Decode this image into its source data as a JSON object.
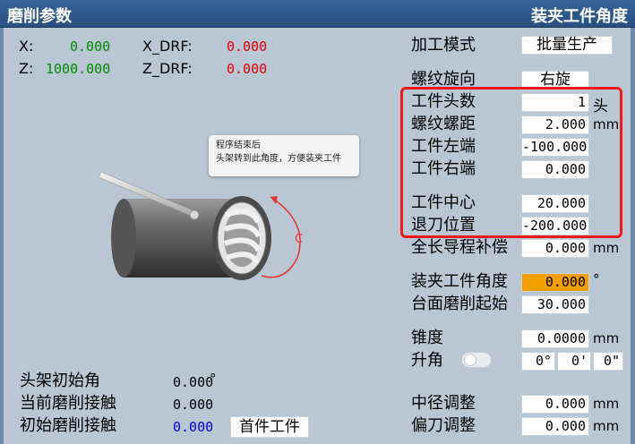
{
  "header": {
    "title_left": "磨削参数",
    "title_right": "装夹工件角度"
  },
  "axes": {
    "x_label": "X:",
    "x_value": "0.000",
    "z_label": "Z:",
    "z_value": "1000.000",
    "xdrf_label": "X_DRF:",
    "xdrf_value": "0.000",
    "zdrf_label": "Z_DRF:",
    "zdrf_value": "0.000"
  },
  "callout": {
    "line1": "程序结束后",
    "line2": "头架转到此角度，方便装夹工件"
  },
  "diagram": {
    "rotation_label": "C"
  },
  "params": {
    "mode_label": "加工模式",
    "mode_value": "批量生产",
    "thread_dir_label": "螺纹旋向",
    "thread_dir_value": "右旋",
    "starts_label": "工件头数",
    "starts_value": "1",
    "starts_unit": "头",
    "pitch_label": "螺纹螺距",
    "pitch_value": "2.000",
    "pitch_unit": "mm",
    "left_label": "工件左端",
    "left_value": "-100.000",
    "right_label": "工件右端",
    "right_value": "0.000",
    "center_label": "工件中心",
    "center_value": "20.000",
    "retract_label": "退刀位置",
    "retract_value": "-200.000",
    "lead_comp_label": "全长导程补偿",
    "lead_comp_value": "0.000",
    "lead_comp_unit": "mm",
    "clamp_angle_label": "装夹工件角度",
    "clamp_angle_value": "0.000",
    "clamp_angle_unit": "°",
    "face_start_label": "台面磨削起始",
    "face_start_value": "30.000",
    "taper_label": "锥度",
    "taper_value": "0.0000",
    "taper_unit": "mm",
    "lift_label": "升角",
    "lift_deg": "0°",
    "lift_min": "0'",
    "lift_sec": "0\"",
    "pitch_dia_label": "中径调整",
    "pitch_dia_value": "0.000",
    "pitch_dia_unit": "mm",
    "offset_label": "偏刀调整",
    "offset_value": "0.000",
    "offset_unit": "mm"
  },
  "status": {
    "head_init_label": "头架初始角",
    "head_init_value": "0.000",
    "head_init_unit": "°",
    "cur_contact_label": "当前磨削接触",
    "cur_contact_value": "0.000",
    "init_contact_label": "初始磨削接触",
    "init_contact_value": "0.000",
    "first_piece_label": "首件工件"
  },
  "colors": {
    "accent": "#2f5d93",
    "highlight": "#f5a000",
    "annotation": "#f01818"
  }
}
